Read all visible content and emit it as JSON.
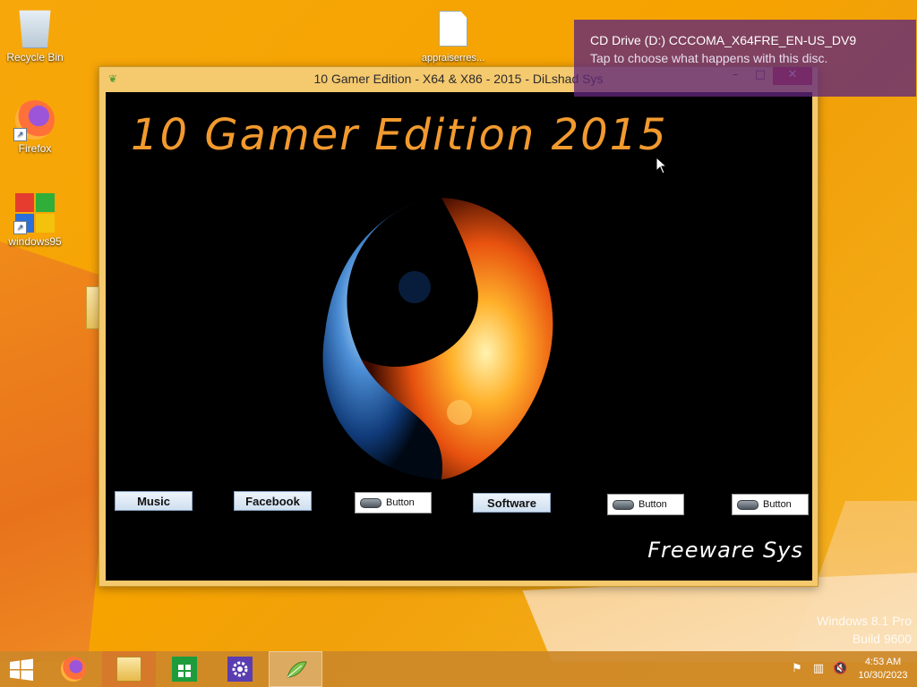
{
  "desktop": {
    "icons": [
      {
        "label": "Recycle Bin",
        "icon": "recycle-bin-icon"
      },
      {
        "label": "Firefox",
        "icon": "firefox-icon"
      },
      {
        "label": "windows95",
        "icon": "windows95-icon"
      },
      {
        "label": "appraiserres...",
        "icon": "file-gear-icon"
      }
    ],
    "watermark": {
      "line1": "Windows 8.1 Pro",
      "line2": "Build 9600"
    }
  },
  "notification": {
    "title": "CD Drive (D:) CCCOMA_X64FRE_EN-US_DV9",
    "message": "Tap to choose what happens with this disc."
  },
  "window": {
    "title": "10 Gamer Edition - X64 & X86 - 2015 - DiLshad Sys",
    "controls": {
      "minimize": "–",
      "maximize": "□",
      "close": "✕"
    },
    "heading": "10 Gamer Edition 2015",
    "buttons": {
      "music": "Music",
      "facebook": "Facebook",
      "button1": "Button",
      "software": "Software",
      "button2": "Button",
      "button3": "Button"
    },
    "footer": "Freeware Sys"
  },
  "taskbar": {
    "apps": [
      "firefox-icon",
      "file-explorer-icon",
      "store-icon",
      "settings-icon",
      "gamer-edition-icon"
    ],
    "clock": {
      "time": "4:53 AM",
      "date": "10/30/2023"
    },
    "tray": [
      "flag-icon",
      "network-icon",
      "volume-muted-icon"
    ]
  },
  "colors": {
    "title_orange": "#f29a2e",
    "toast_purple": "#5f267a",
    "taskbar": "#cd8828"
  }
}
